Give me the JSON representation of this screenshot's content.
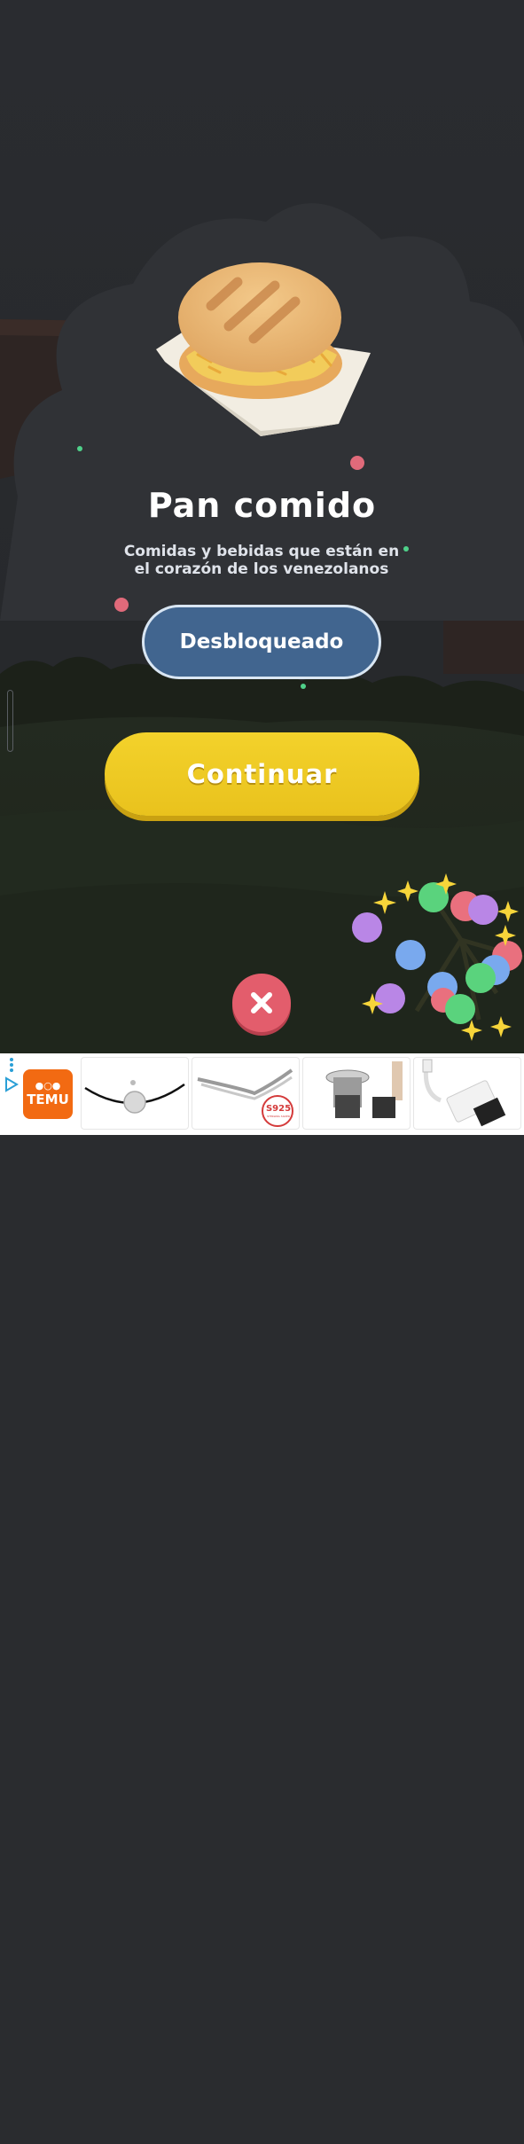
{
  "card": {
    "title": "Pan comido",
    "subtitle_line1": "Comidas y bebidas que están en",
    "subtitle_line2": "el corazón de los venezolanos"
  },
  "buttons": {
    "unlocked_label": "Desbloqueado",
    "continue_label": "Continuar",
    "close_icon": "close-icon"
  },
  "ad": {
    "brand_name": "TEMU",
    "brand_glyph": "TEMU",
    "badge_label": "S925",
    "badge_sub": "STERLING SILVER",
    "icons": [
      "ad-choices-icon",
      "more-options-icon"
    ],
    "products": [
      "bracelet",
      "ring",
      "sink-strainer",
      "card-reader"
    ]
  },
  "colors": {
    "background": "#2a2c2f",
    "unlocked_button": "#41658f",
    "continue_button": "#f0cb24",
    "close_button": "#e35d6c",
    "ad_brand": "#f26a12"
  }
}
